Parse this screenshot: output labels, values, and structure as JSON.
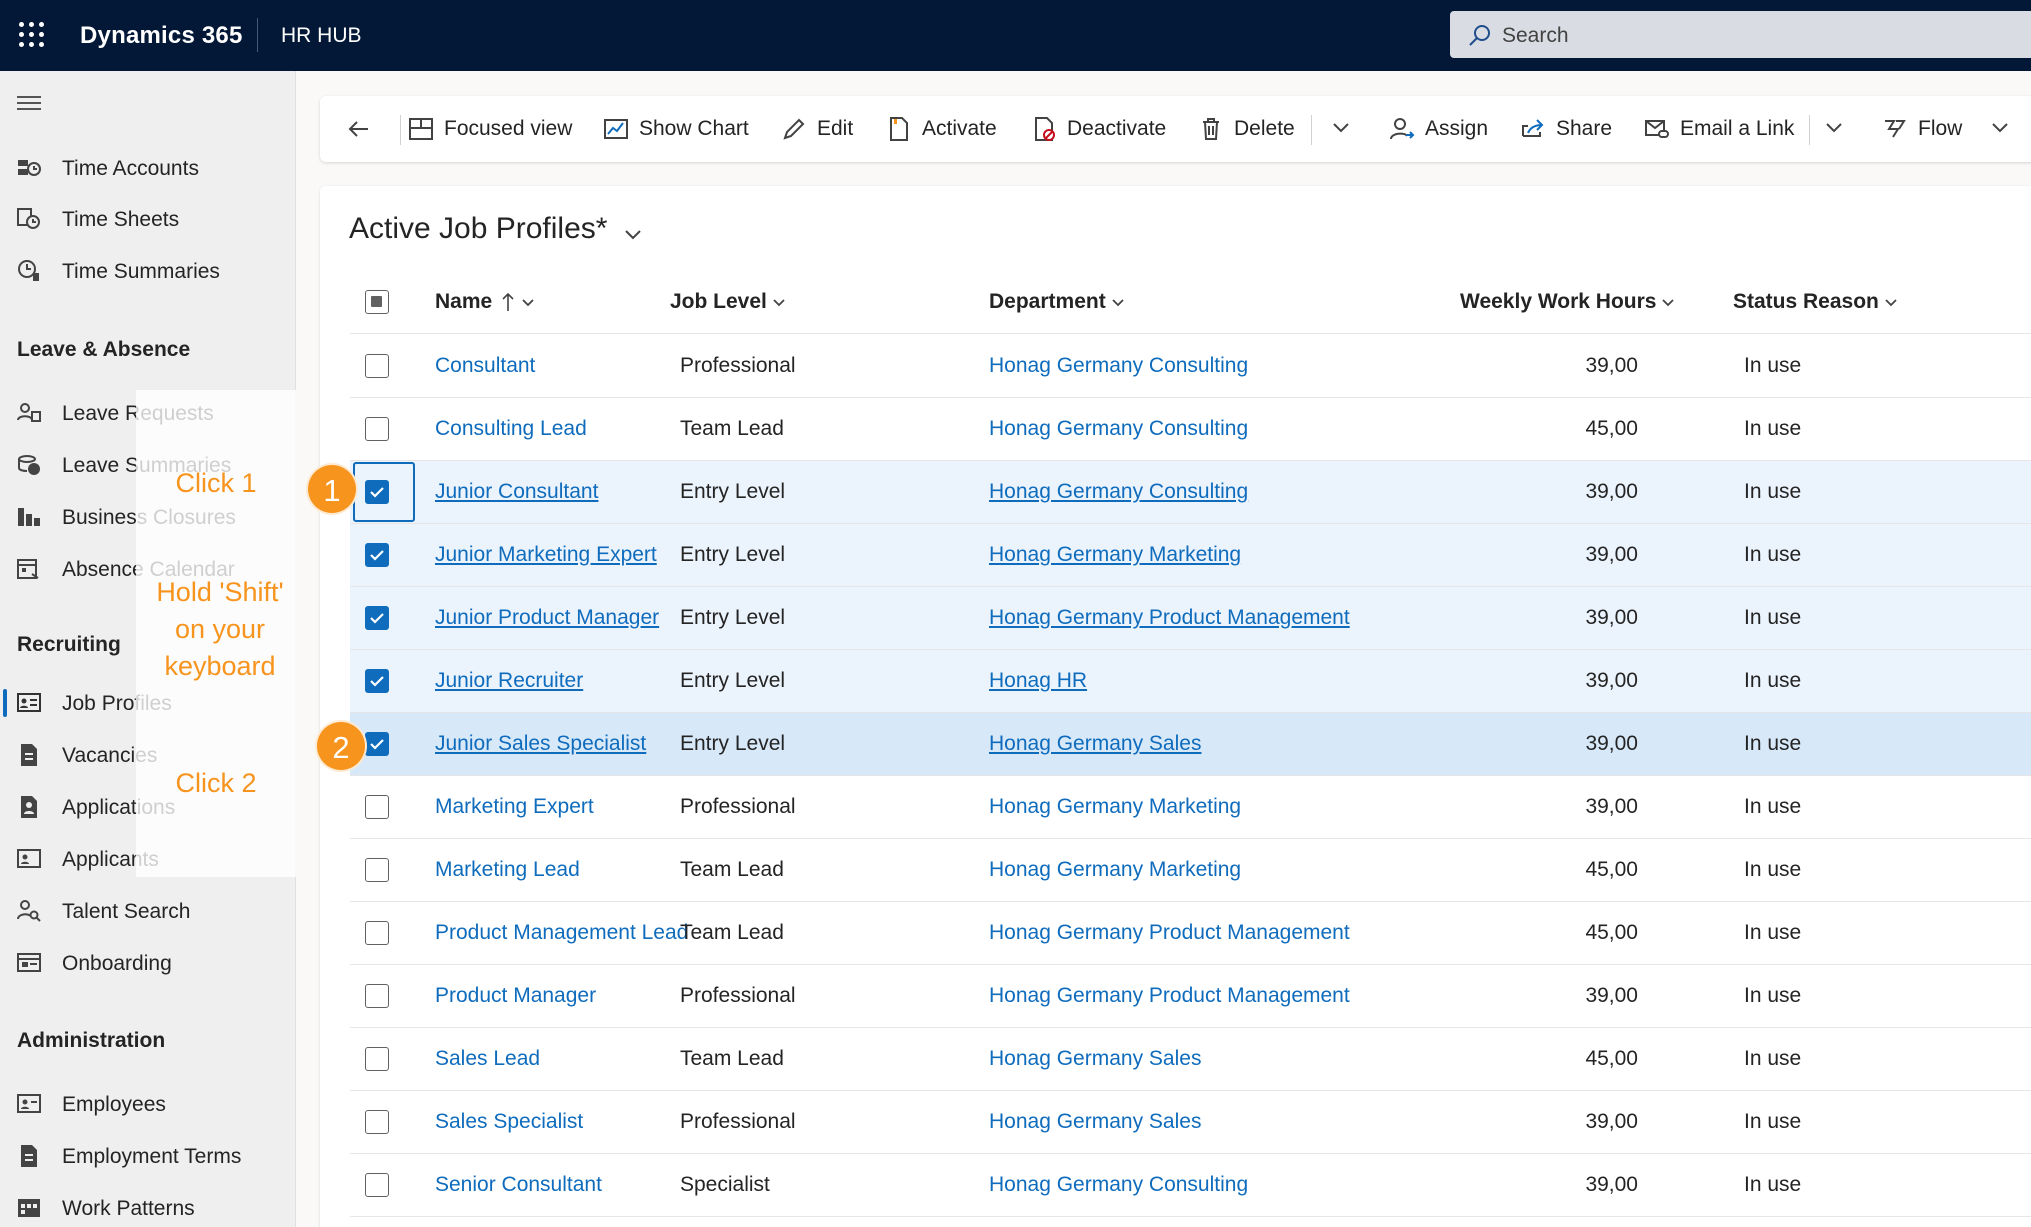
{
  "topbar": {
    "brand": "Dynamics 365",
    "app": "HR HUB",
    "search_placeholder": "Search"
  },
  "sidebar": {
    "items_top": [
      {
        "label": "Time Accounts",
        "icon": "time-accounts-icon"
      },
      {
        "label": "Time Sheets",
        "icon": "time-sheets-icon"
      },
      {
        "label": "Time Summaries",
        "icon": "time-summaries-icon"
      }
    ],
    "group_leave": "Leave & Absence",
    "items_leave": [
      {
        "label": "Leave Requests",
        "icon": "leave-requests-icon"
      },
      {
        "label": "Leave Summaries",
        "icon": "leave-summaries-icon"
      },
      {
        "label": "Business Closures",
        "icon": "business-closures-icon"
      },
      {
        "label": "Absence Calendar",
        "icon": "absence-calendar-icon"
      }
    ],
    "group_recruiting": "Recruiting",
    "items_recruiting": [
      {
        "label": "Job Profiles",
        "icon": "job-profiles-icon",
        "active": true
      },
      {
        "label": "Vacancies",
        "icon": "vacancies-icon"
      },
      {
        "label": "Applications",
        "icon": "applications-icon"
      },
      {
        "label": "Applicants",
        "icon": "applicants-icon"
      },
      {
        "label": "Talent Search",
        "icon": "talent-search-icon"
      },
      {
        "label": "Onboarding",
        "icon": "onboarding-icon"
      }
    ],
    "group_admin": "Administration",
    "items_admin": [
      {
        "label": "Employees",
        "icon": "employees-icon"
      },
      {
        "label": "Employment Terms",
        "icon": "employment-terms-icon"
      },
      {
        "label": "Work Patterns",
        "icon": "work-patterns-icon"
      }
    ]
  },
  "tips": {
    "click1": "Click 1",
    "shift": "Hold 'Shift' on your keyboard",
    "click2": "Click 2",
    "badge1": "1",
    "badge2": "2"
  },
  "commands": {
    "focused_view": "Focused view",
    "show_chart": "Show Chart",
    "edit": "Edit",
    "activate": "Activate",
    "deactivate": "Deactivate",
    "delete": "Delete",
    "assign": "Assign",
    "share": "Share",
    "email_link": "Email a Link",
    "flow": "Flow"
  },
  "view": {
    "title": "Active Job Profiles*"
  },
  "columns": {
    "name": "Name",
    "level": "Job Level",
    "dept": "Department",
    "hours": "Weekly Work Hours",
    "status": "Status Reason"
  },
  "rows": [
    {
      "name": "Consultant",
      "level": "Professional",
      "dept": "Honag Germany Consulting",
      "hours": "39,00",
      "status": "In use",
      "selected": false
    },
    {
      "name": "Consulting Lead",
      "level": "Team Lead",
      "dept": "Honag Germany Consulting",
      "hours": "45,00",
      "status": "In use",
      "selected": false
    },
    {
      "name": "Junior Consultant",
      "level": "Entry Level",
      "dept": "Honag Germany Consulting",
      "hours": "39,00",
      "status": "In use",
      "selected": true
    },
    {
      "name": "Junior Marketing Expert",
      "level": "Entry Level",
      "dept": "Honag Germany Marketing",
      "hours": "39,00",
      "status": "In use",
      "selected": true
    },
    {
      "name": "Junior Product Manager",
      "level": "Entry Level",
      "dept": "Honag Germany Product Management",
      "hours": "39,00",
      "status": "In use",
      "selected": true
    },
    {
      "name": "Junior Recruiter",
      "level": "Entry Level",
      "dept": "Honag HR",
      "hours": "39,00",
      "status": "In use",
      "selected": true
    },
    {
      "name": "Junior Sales Specialist",
      "level": "Entry Level",
      "dept": "Honag Germany Sales",
      "hours": "39,00",
      "status": "In use",
      "selected": true
    },
    {
      "name": "Marketing Expert",
      "level": "Professional",
      "dept": "Honag Germany Marketing",
      "hours": "39,00",
      "status": "In use",
      "selected": false
    },
    {
      "name": "Marketing Lead",
      "level": "Team Lead",
      "dept": "Honag Germany Marketing",
      "hours": "45,00",
      "status": "In use",
      "selected": false
    },
    {
      "name": "Product Management Lead",
      "level": "Team Lead",
      "dept": "Honag Germany Product Management",
      "hours": "45,00",
      "status": "In use",
      "selected": false
    },
    {
      "name": "Product Manager",
      "level": "Professional",
      "dept": "Honag Germany Product Management",
      "hours": "39,00",
      "status": "In use",
      "selected": false
    },
    {
      "name": "Sales Lead",
      "level": "Team Lead",
      "dept": "Honag Germany Sales",
      "hours": "45,00",
      "status": "In use",
      "selected": false
    },
    {
      "name": "Sales Specialist",
      "level": "Professional",
      "dept": "Honag Germany Sales",
      "hours": "39,00",
      "status": "In use",
      "selected": false
    },
    {
      "name": "Senior Consultant",
      "level": "Specialist",
      "dept": "Honag Germany Consulting",
      "hours": "39,00",
      "status": "In use",
      "selected": false
    }
  ],
  "colors": {
    "topbar": "#031837",
    "link": "#0f6cbd",
    "accent": "#f7941d",
    "selected_row": "#ebf3fc"
  }
}
